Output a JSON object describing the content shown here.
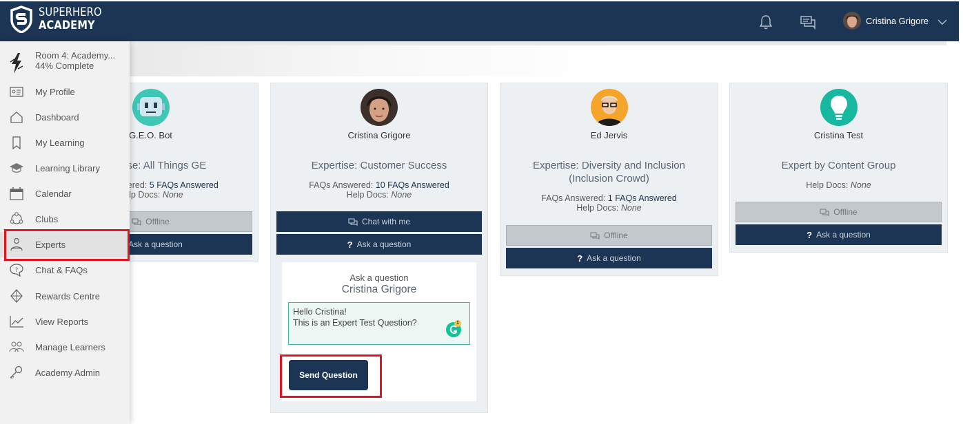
{
  "brand": {
    "line1": "SUPERHERO",
    "line2": "ACADEMY"
  },
  "topbar": {
    "user_name": "Cristina Grigore"
  },
  "sidebar": {
    "room_title": "Room 4: Academy...",
    "room_progress": "44% Complete",
    "items": [
      {
        "label": "My Profile",
        "icon": "profile-card-icon"
      },
      {
        "label": "Dashboard",
        "icon": "home-icon"
      },
      {
        "label": "My Learning",
        "icon": "bookmark-icon"
      },
      {
        "label": "Learning Library",
        "icon": "graduation-cap-icon"
      },
      {
        "label": "Calendar",
        "icon": "calendar-icon"
      },
      {
        "label": "Clubs",
        "icon": "clubs-icon"
      },
      {
        "label": "Experts",
        "icon": "expert-icon",
        "active": true
      },
      {
        "label": "Chat & FAQs",
        "icon": "question-bubble-icon"
      },
      {
        "label": "Rewards Centre",
        "icon": "diamond-icon"
      },
      {
        "label": "View Reports",
        "icon": "line-chart-icon"
      },
      {
        "label": "Manage Learners",
        "icon": "people-icon"
      },
      {
        "label": "Academy Admin",
        "icon": "key-icon"
      }
    ]
  },
  "experts": [
    {
      "name": "G.E.O. Bot",
      "expertise": "Expertise: All Things GE",
      "faqs_label": "FAQs Answered:",
      "faqs_value": "5 FAQs Answered",
      "docs_label": "Help Docs:",
      "docs_value": "None",
      "status_label": "Offline",
      "ask_label": "Ask a question"
    },
    {
      "name": "Cristina Grigore",
      "expertise": "Expertise: Customer Success",
      "faqs_label": "FAQs Answered:",
      "faqs_value": "10 FAQs Answered",
      "docs_label": "Help Docs:",
      "docs_value": "None",
      "status_label": "Chat with me",
      "ask_label": "Ask a question"
    },
    {
      "name": "Ed Jervis",
      "expertise_line1": "Expertise: Diversity and Inclusion",
      "expertise_line2": "(Inclusion Crowd)",
      "faqs_label": "FAQs Answered:",
      "faqs_value": "1 FAQs Answered",
      "docs_label": "Help Docs:",
      "docs_value": "None",
      "status_label": "Offline",
      "ask_label": "Ask a question"
    },
    {
      "name": "Cristina Test",
      "expertise": "Expert by Content Group",
      "docs_label": "Help Docs:",
      "docs_value": "None",
      "status_label": "Offline",
      "ask_label": "Ask a question"
    }
  ],
  "ask_panel": {
    "title": "Ask a question",
    "expert_name": "Cristina Grigore",
    "question_text": "Hello Cristina!\nThis is an Expert Test Question?",
    "grammarly_count": "1",
    "send_label": "Send Question"
  },
  "colors": {
    "navy": "#1c3554",
    "highlight": "#e0141e",
    "grammarly": "#15c39a"
  }
}
